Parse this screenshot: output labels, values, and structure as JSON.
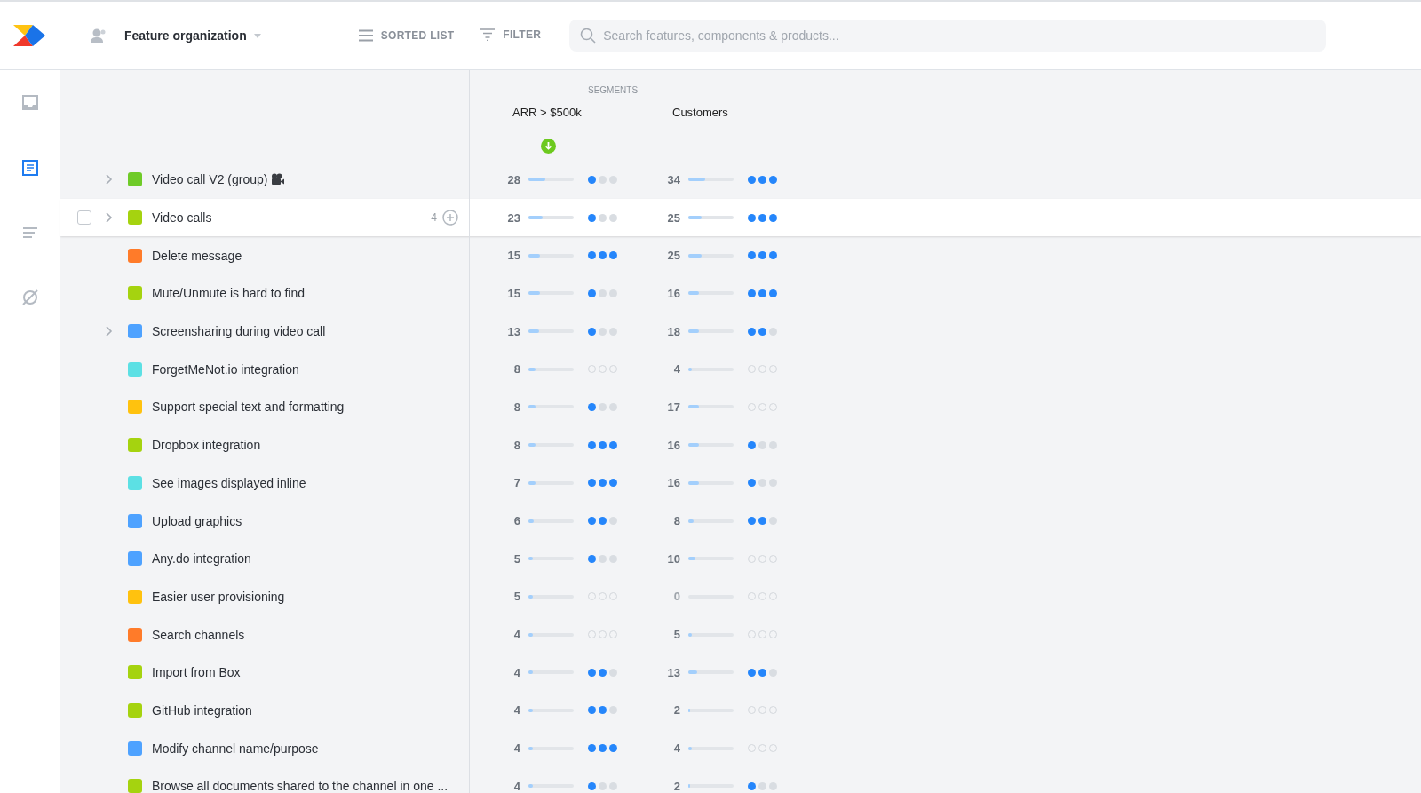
{
  "sidebar": {
    "items": [
      {
        "selected": false
      },
      {
        "selected": true
      },
      {
        "selected": false
      },
      {
        "selected": false
      }
    ]
  },
  "toolbar": {
    "workspace": "Feature organization",
    "sorted_list": "SORTED LIST",
    "filter": "FILTER",
    "search": {
      "placeholder": "Search features, components & products..."
    }
  },
  "segments": {
    "title": "SEGMENTS",
    "columns": [
      {
        "label": "ARR > $500k",
        "sorted": true
      },
      {
        "label": "Customers",
        "sorted": false
      }
    ]
  },
  "rows": [
    {
      "name": "Video call V2 (group)",
      "kind": "group",
      "color": "#6fcb28",
      "expandable": true,
      "selected": false,
      "metrics": [
        {
          "value": "28",
          "level": 0.38,
          "stars": 1
        },
        {
          "value": "34",
          "level": 0.38,
          "stars": 3
        }
      ]
    },
    {
      "name": "Video calls",
      "kind": "feature",
      "color": "#a5d30f",
      "expandable": true,
      "selected": true,
      "count": "4",
      "metrics": [
        {
          "value": "23",
          "level": 0.32,
          "stars": 1
        },
        {
          "value": "25",
          "level": 0.3,
          "stars": 3
        }
      ]
    },
    {
      "name": "Delete message",
      "kind": "feature",
      "color": "#ff7b29",
      "expandable": false,
      "selected": false,
      "metrics": [
        {
          "value": "15",
          "level": 0.25,
          "stars": 3
        },
        {
          "value": "25",
          "level": 0.3,
          "stars": 3
        }
      ]
    },
    {
      "name": "Mute/Unmute is hard to find",
      "kind": "feature",
      "color": "#a5d30f",
      "expandable": false,
      "selected": false,
      "metrics": [
        {
          "value": "15",
          "level": 0.25,
          "stars": 1
        },
        {
          "value": "16",
          "level": 0.24,
          "stars": 3
        }
      ]
    },
    {
      "name": "Screensharing during video call",
      "kind": "feature",
      "color": "#4ea2ff",
      "expandable": true,
      "selected": false,
      "metrics": [
        {
          "value": "13",
          "level": 0.23,
          "stars": 1
        },
        {
          "value": "18",
          "level": 0.24,
          "stars": 2
        }
      ]
    },
    {
      "name": "ForgetMeNot.io integration",
      "kind": "feature",
      "color": "#5ce0e4",
      "expandable": false,
      "selected": false,
      "metrics": [
        {
          "value": "8",
          "level": 0.15,
          "stars": 0
        },
        {
          "value": "4",
          "level": 0.07,
          "stars": 0
        }
      ]
    },
    {
      "name": "Support special text and formatting",
      "kind": "feature",
      "color": "#ffc20e",
      "expandable": false,
      "selected": false,
      "metrics": [
        {
          "value": "8",
          "level": 0.15,
          "stars": 1
        },
        {
          "value": "17",
          "level": 0.24,
          "stars": 0
        }
      ]
    },
    {
      "name": "Dropbox integration",
      "kind": "feature",
      "color": "#a5d30f",
      "expandable": false,
      "selected": false,
      "metrics": [
        {
          "value": "8",
          "level": 0.15,
          "stars": 3
        },
        {
          "value": "16",
          "level": 0.24,
          "stars": 1
        }
      ]
    },
    {
      "name": "See images displayed inline",
      "kind": "feature",
      "color": "#5ce0e4",
      "expandable": false,
      "selected": false,
      "metrics": [
        {
          "value": "7",
          "level": 0.15,
          "stars": 3
        },
        {
          "value": "16",
          "level": 0.24,
          "stars": 1
        }
      ]
    },
    {
      "name": "Upload graphics",
      "kind": "feature",
      "color": "#4ea2ff",
      "expandable": false,
      "selected": false,
      "metrics": [
        {
          "value": "6",
          "level": 0.12,
          "stars": 2
        },
        {
          "value": "8",
          "level": 0.12,
          "stars": 2
        }
      ]
    },
    {
      "name": "Any.do integration",
      "kind": "feature",
      "color": "#4ea2ff",
      "expandable": false,
      "selected": false,
      "metrics": [
        {
          "value": "5",
          "level": 0.1,
          "stars": 1
        },
        {
          "value": "10",
          "level": 0.16,
          "stars": 0
        }
      ]
    },
    {
      "name": "Easier user provisioning",
      "kind": "feature",
      "color": "#ffc20e",
      "expandable": false,
      "selected": false,
      "metrics": [
        {
          "value": "5",
          "level": 0.1,
          "stars": 0
        },
        {
          "value": "0",
          "level": 0,
          "stars": 0
        }
      ]
    },
    {
      "name": "Search channels",
      "kind": "feature",
      "color": "#ff7b29",
      "expandable": false,
      "selected": false,
      "metrics": [
        {
          "value": "4",
          "level": 0.1,
          "stars": 0
        },
        {
          "value": "5",
          "level": 0.08,
          "stars": 0
        }
      ]
    },
    {
      "name": "Import from Box",
      "kind": "feature",
      "color": "#a5d30f",
      "expandable": false,
      "selected": false,
      "metrics": [
        {
          "value": "4",
          "level": 0.1,
          "stars": 2
        },
        {
          "value": "13",
          "level": 0.19,
          "stars": 2
        }
      ]
    },
    {
      "name": "GitHub integration",
      "kind": "feature",
      "color": "#a5d30f",
      "expandable": false,
      "selected": false,
      "metrics": [
        {
          "value": "4",
          "level": 0.1,
          "stars": 2
        },
        {
          "value": "2",
          "level": 0.03,
          "stars": 0
        }
      ]
    },
    {
      "name": "Modify channel name/purpose",
      "kind": "feature",
      "color": "#4ea2ff",
      "expandable": false,
      "selected": false,
      "metrics": [
        {
          "value": "4",
          "level": 0.1,
          "stars": 3
        },
        {
          "value": "4",
          "level": 0.07,
          "stars": 0
        }
      ]
    },
    {
      "name": "Browse all documents shared to the channel in one ...",
      "kind": "feature",
      "color": "#a5d30f",
      "expandable": false,
      "selected": false,
      "metrics": [
        {
          "value": "4",
          "level": 0.1,
          "stars": 1
        },
        {
          "value": "2",
          "level": 0.03,
          "stars": 1
        }
      ]
    }
  ]
}
